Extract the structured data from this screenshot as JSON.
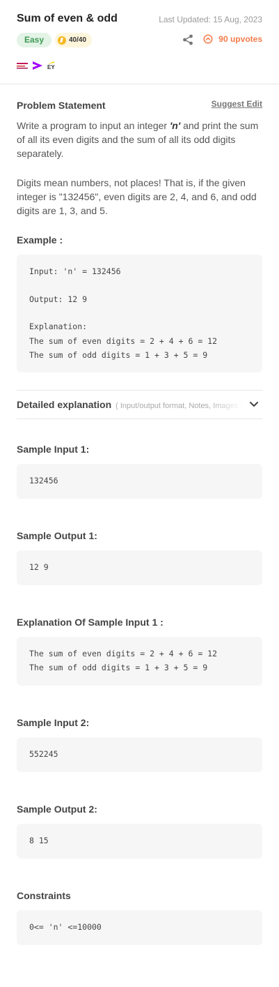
{
  "header": {
    "title": "Sum of even & odd",
    "last_updated": "Last Updated: 15 Aug, 2023",
    "difficulty": "Easy",
    "score": "40/40",
    "upvotes": "90 upvotes",
    "icons": [
      "share-icon",
      "upvote-icon",
      "coin-icon"
    ],
    "company_logos": [
      "company-logo-1",
      "accenture-logo",
      "ey-logo"
    ],
    "ey_text": "EY"
  },
  "problem": {
    "heading": "Problem Statement",
    "suggest_edit": "Suggest Edit",
    "para1": [
      "Write a program to input an integer ",
      "'n'",
      " and print the sum of all its even digits and the sum of all its odd digits separately."
    ],
    "para2": "Digits mean numbers, not places! That is, if the given integer is \"132456\", even digits are 2, 4, and 6, and odd digits are 1, 3, and 5."
  },
  "example": {
    "heading": "Example :",
    "lines": [
      "Input: 'n' = 132456",
      "Output: 12 9",
      "Explanation:",
      "The sum of even digits = 2 + 4 + 6 = 12",
      "The sum of odd digits = 1 + 3 + 5 = 9"
    ]
  },
  "detailed": {
    "title": "Detailed explanation",
    "subtitle": "( Input/output format, Notes, Images )"
  },
  "samples": {
    "input1_heading": "Sample Input 1:",
    "input1": "132456",
    "output1_heading": "Sample Output 1:",
    "output1": "12 9",
    "explanation1_heading": "Explanation Of Sample Input 1 :",
    "explanation1_lines": [
      "The sum of even digits = 2 + 4 + 6 = 12",
      "The sum of odd digits = 1 + 3 + 5 = 9"
    ],
    "input2_heading": "Sample Input 2:",
    "input2": "552245",
    "output2_heading": "Sample Output 2:",
    "output2": "8 15"
  },
  "constraints": {
    "heading": "Constraints",
    "text": "0<= 'n' <=10000"
  },
  "colors": {
    "easy_bg": "#e3f3e6",
    "easy_text": "#3e9a54",
    "upvote": "#f47c4a",
    "code_bg": "#f6f6f6",
    "accenture": "#a100ff"
  }
}
